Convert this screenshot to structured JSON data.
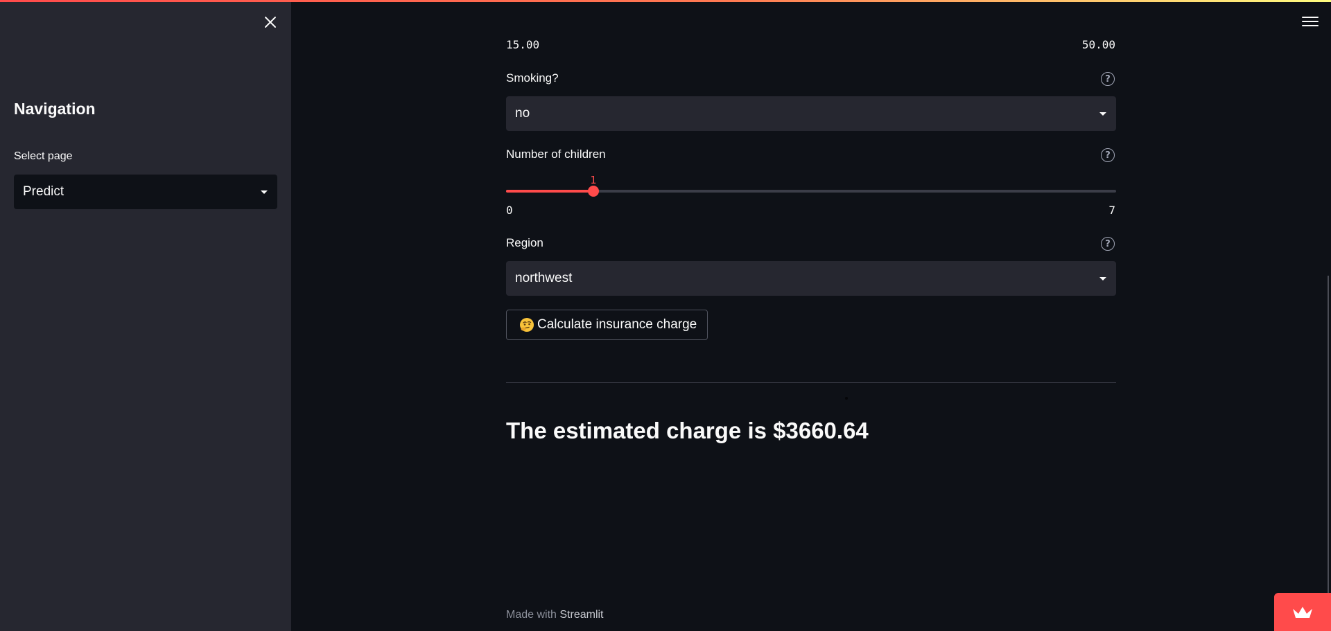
{
  "sidebar": {
    "title": "Navigation",
    "select_label": "Select page",
    "select_value": "Predict"
  },
  "main": {
    "bmi_range": {
      "min": "15.00",
      "max": "50.00"
    },
    "smoking": {
      "label": "Smoking?",
      "value": "no"
    },
    "children": {
      "label": "Number of children",
      "value": 1,
      "value_label": "1",
      "min": 0,
      "max": 7,
      "min_label": "0",
      "max_label": "7"
    },
    "region": {
      "label": "Region",
      "value": "northwest"
    },
    "button_label": "Calculate insurance charge",
    "result": "The estimated charge is $3660.64"
  },
  "footer": {
    "prefix": "Made with",
    "link": "Streamlit"
  },
  "colors": {
    "accent": "#ff4b4b",
    "background": "#0e1117",
    "sidebar": "#262730"
  },
  "icons": {
    "close": "close-icon",
    "menu": "hamburger-menu-icon",
    "help": "help-circle-icon",
    "dropdown": "caret-down-icon",
    "emoji": "thinking-face-icon",
    "badge": "streamlit-crown-icon"
  }
}
